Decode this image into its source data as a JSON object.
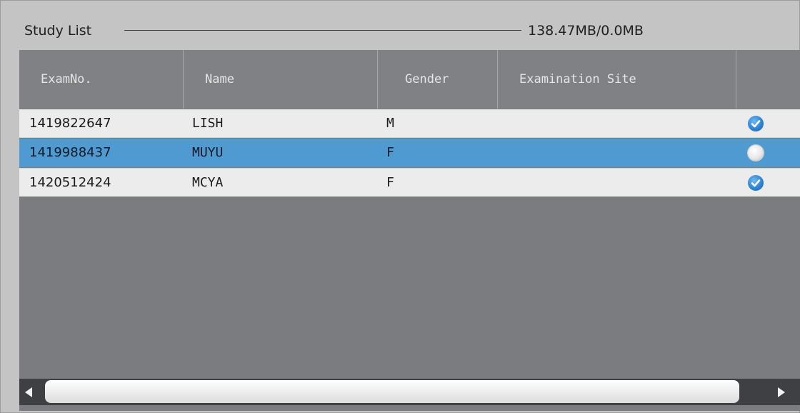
{
  "panel": {
    "title": "Study List",
    "size_info": "138.47MB/0.0MB"
  },
  "table": {
    "columns": [
      "ExamNo.",
      "Name",
      "Gender",
      "Examination Site",
      ""
    ],
    "rows": [
      {
        "exam_no": "1419822647",
        "name": "LISH",
        "gender": "M",
        "site": "",
        "checked": true
      },
      {
        "exam_no": "1419988437",
        "name": "MUYU",
        "gender": "F",
        "site": "",
        "checked": false,
        "selected": true
      },
      {
        "exam_no": "1420512424",
        "name": "MCYA",
        "gender": "F",
        "site": "",
        "checked": true
      }
    ]
  },
  "icons": {
    "checked": "check-circle-icon",
    "unchecked": "empty-circle-icon",
    "scroll_left": "arrow-left-icon",
    "scroll_right": "arrow-right-icon"
  },
  "colors": {
    "selected_row": "#4f9bd1",
    "check_blue": "#2a7fd0",
    "table_background": "#7b7c7f"
  }
}
